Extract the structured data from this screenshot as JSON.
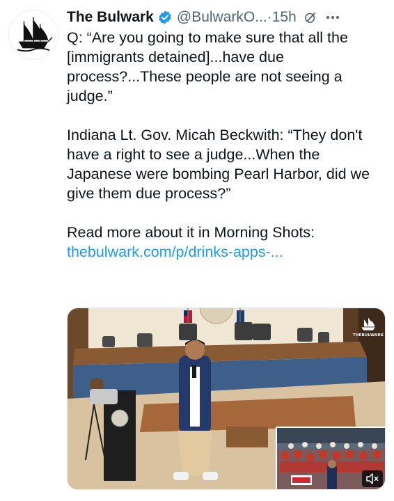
{
  "tweet": {
    "author_name": "The Bulwark",
    "handle": "@BulwarkO...",
    "separator": "·",
    "time": "15h",
    "paragraphs": [
      "Q: “Are you going to make sure that all the [immigrants detained]...have due process?...These people are not seeing a judge.”",
      "Indiana Lt. Gov. Micah Beckwith: “They don't have a right to see a judge...When the Japanese were bombing Pearl Harbor, did we give them due process?”",
      "Read more about it in Morning Shots:"
    ],
    "link_text": "thebulwark.com/p/drinks-apps-...",
    "media": {
      "watermark": "THEBULWARK"
    }
  },
  "icons": {
    "avatar": "pirate-ship-logo",
    "verified": "verified-badge-icon",
    "grok": "grok-icon",
    "more": "more-options-icon",
    "mute": "speaker-muted-icon"
  },
  "colors": {
    "text": "#0f1419",
    "secondary": "#536471",
    "link": "#1d9bf0",
    "verified": "#1d9bf0"
  }
}
